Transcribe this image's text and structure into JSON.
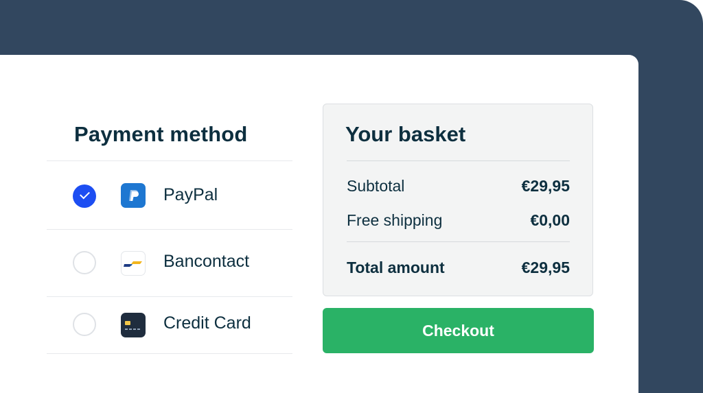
{
  "payment": {
    "title": "Payment method",
    "methods": [
      {
        "label": "PayPal",
        "selected": true,
        "icon": "paypal-logo"
      },
      {
        "label": "Bancontact",
        "selected": false,
        "icon": "bancontact-logo"
      },
      {
        "label": "Credit Card",
        "selected": false,
        "icon": "credit-card-icon"
      }
    ]
  },
  "basket": {
    "title": "Your basket",
    "subtotal_label": "Subtotal",
    "subtotal_value": "€29,95",
    "shipping_label": "Free shipping",
    "shipping_value": "€0,00",
    "total_label": "Total amount",
    "total_value": "€29,95"
  },
  "checkout_label": "Checkout",
  "colors": {
    "navy_background": "#32475f",
    "heading_text": "#0d2f3f",
    "radio_selected": "#1d4ef2",
    "checkout_green": "#2ab266",
    "basket_panel": "#f3f4f4"
  }
}
